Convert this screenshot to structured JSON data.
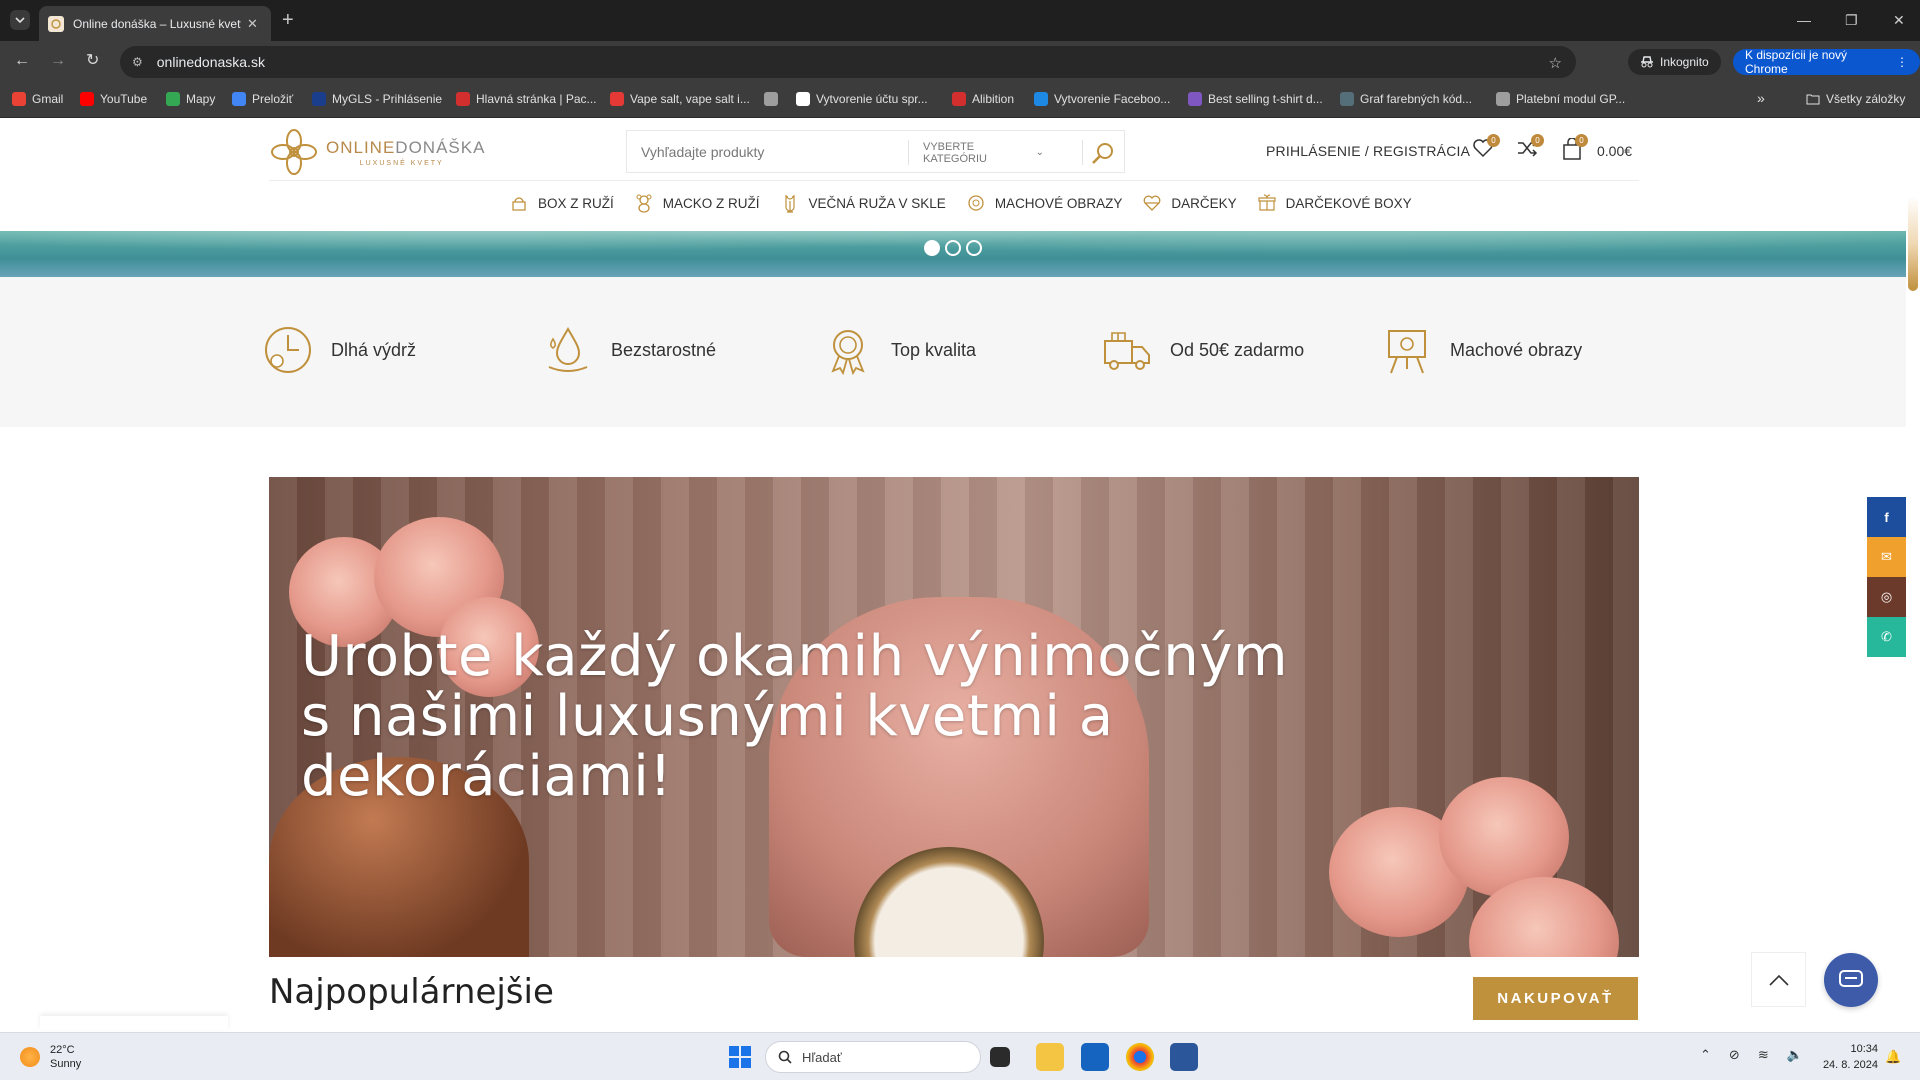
{
  "browser": {
    "tab_title": "Online donáška – Luxusné kvety",
    "new_tab": "+",
    "url": "onlinedonaska.sk",
    "incognito_label": "Inkognito",
    "update_label": "K dispozícii je nový Chrome",
    "bookmarks": [
      {
        "label": "Gmail",
        "color": "#ea4335"
      },
      {
        "label": "YouTube",
        "color": "#ff0000"
      },
      {
        "label": "Mapy",
        "color": "#34a853"
      },
      {
        "label": "Preložiť",
        "color": "#4285f4"
      },
      {
        "label": "MyGLS - Prihlásenie",
        "color": "#1a3e8c"
      },
      {
        "label": "Hlavná stránka | Pac...",
        "color": "#d32f2f"
      },
      {
        "label": "Vape salt, vape salt i...",
        "color": "#e53935"
      },
      {
        "label": "",
        "color": "#9e9e9e"
      },
      {
        "label": "Vytvorenie účtu spr...",
        "color": "#ffffff"
      },
      {
        "label": "Alibition",
        "color": "#d32f2f"
      },
      {
        "label": "Vytvorenie Faceboo...",
        "color": "#1e88e5"
      },
      {
        "label": "Best selling t-shirt d...",
        "color": "#7e57c2"
      },
      {
        "label": "Graf farebných kód...",
        "color": "#546e7a"
      },
      {
        "label": "Platební modul GP...",
        "color": "#9e9e9e"
      }
    ],
    "bookmarks_overflow": "»",
    "all_bookmarks": "Všetky záložky"
  },
  "site": {
    "logo_online": "ONLINE",
    "logo_donaska": "DONÁŠKA",
    "logo_tagline": "LUXUSNÉ KVETY",
    "search_placeholder": "Vyhľadajte produkty",
    "category_label": "VYBERTE KATEGÓRIU",
    "login_label": "PRIHLÁSENIE / REGISTRÁCIA",
    "wishlist_count": "0",
    "compare_count": "0",
    "cart_count": "0",
    "cart_total": "0.00€",
    "nav": [
      {
        "label": "BOX Z RUŽÍ",
        "icon": "rose-box-icon"
      },
      {
        "label": "MACKO Z RUŽÍ",
        "icon": "teddy-bear-icon"
      },
      {
        "label": "VEČNÁ RUŽA V SKLE",
        "icon": "rose-glass-icon"
      },
      {
        "label": "MACHOVÉ OBRAZY",
        "icon": "moss-icon"
      },
      {
        "label": "DARČEKY",
        "icon": "heart-gift-icon"
      },
      {
        "label": "DARČEKOVÉ BOXY",
        "icon": "gift-box-icon"
      }
    ],
    "slider_dots": 3,
    "features": [
      {
        "label": "Dlhá výdrž",
        "icon": "clock-icon"
      },
      {
        "label": "Bezstarostné",
        "icon": "water-drops-icon"
      },
      {
        "label": "Top kvalita",
        "icon": "award-icon"
      },
      {
        "label": "Od 50€ zadarmo",
        "icon": "delivery-truck-icon"
      },
      {
        "label": "Machové obrazy",
        "icon": "easel-icon"
      }
    ],
    "hero_title": "Urobte každý okamih výnimočným s našimi luxusnými kvetmi a dekoráciami!",
    "section_title": "Najpopulárnejšie",
    "shop_button": "NAKUPOVAŤ",
    "share": [
      {
        "icon": "facebook-icon",
        "color": "#1d4e9d",
        "glyph": "f"
      },
      {
        "icon": "email-icon",
        "color": "#f0a02c",
        "glyph": "✉"
      },
      {
        "icon": "instagram-icon",
        "color": "#6b3a2b",
        "glyph": "◎"
      },
      {
        "icon": "whatsapp-icon",
        "color": "#27b79b",
        "glyph": "✆"
      }
    ]
  },
  "taskbar": {
    "temp": "22°C",
    "condition": "Sunny",
    "search_label": "Hľadať",
    "time": "10:34",
    "date": "24. 8. 2024"
  },
  "colors": {
    "accent": "#c0913d",
    "brand_text": "#b8894a"
  }
}
